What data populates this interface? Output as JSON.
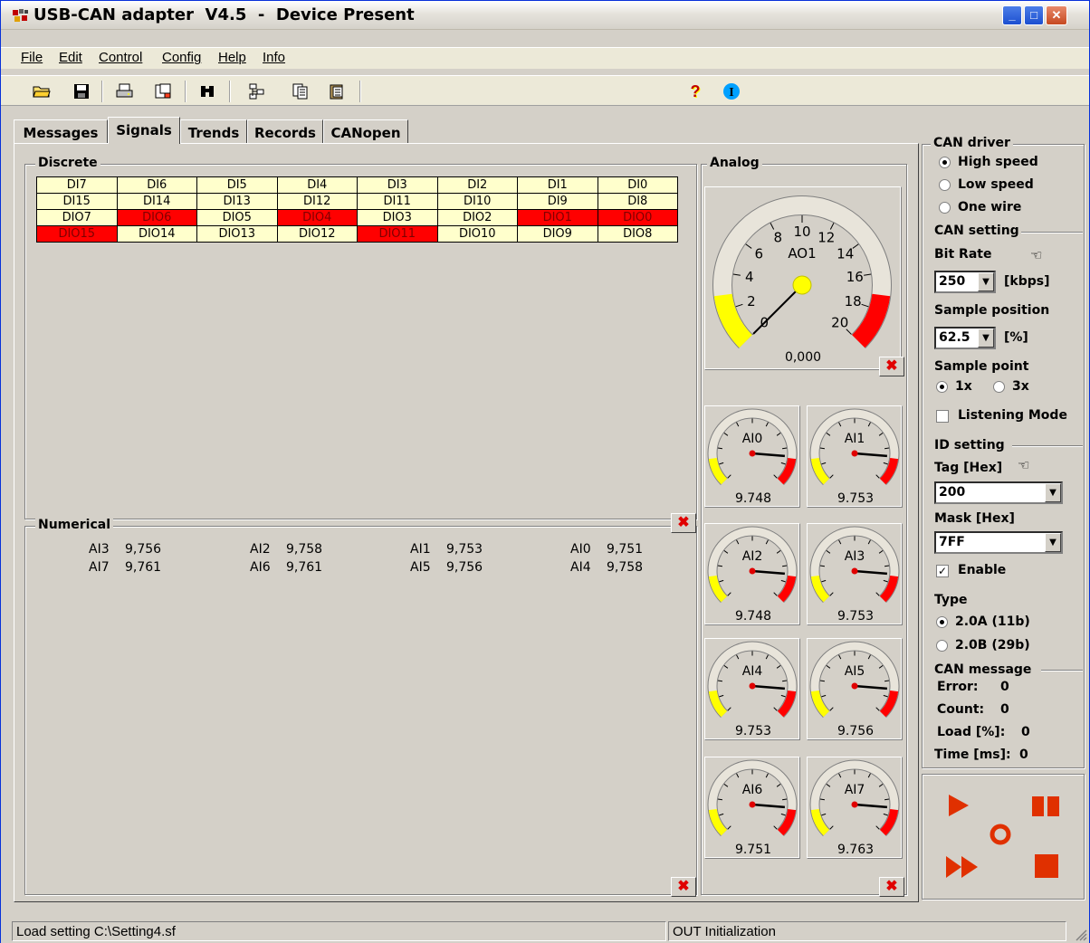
{
  "window": {
    "title": "USB-CAN adapter  V4.5  -  Device Present",
    "app_icon": "usb-can-app-icon",
    "controls": [
      "minimize",
      "maximize",
      "close"
    ]
  },
  "menu": [
    "File",
    "Edit",
    "Control",
    "Config",
    "Help",
    "Info"
  ],
  "toolbar": {
    "icons": [
      "open-folder-icon",
      "save-disk-icon",
      "print-preview-icon",
      "export-icon",
      "find-binoculars-icon",
      "tree-icon",
      "copy-icon",
      "clipboard-icon",
      "help-icon",
      "info-icon"
    ]
  },
  "tabs": [
    "Messages",
    "Signals",
    "Trends",
    "Records",
    "CANopen"
  ],
  "active_tab": "Signals",
  "discrete": {
    "label": "Discrete",
    "rows": [
      [
        {
          "t": "DI7",
          "on": false
        },
        {
          "t": "DI6",
          "on": false
        },
        {
          "t": "DI5",
          "on": false
        },
        {
          "t": "DI4",
          "on": false
        },
        {
          "t": "DI3",
          "on": false
        },
        {
          "t": "DI2",
          "on": false
        },
        {
          "t": "DI1",
          "on": false
        },
        {
          "t": "DI0",
          "on": false
        }
      ],
      [
        {
          "t": "DI15",
          "on": false
        },
        {
          "t": "DI14",
          "on": false
        },
        {
          "t": "DI13",
          "on": false
        },
        {
          "t": "DI12",
          "on": false
        },
        {
          "t": "DI11",
          "on": false
        },
        {
          "t": "DI10",
          "on": false
        },
        {
          "t": "DI9",
          "on": false
        },
        {
          "t": "DI8",
          "on": false
        }
      ],
      [
        {
          "t": "DIO7",
          "on": false
        },
        {
          "t": "DIO6",
          "on": true
        },
        {
          "t": "DIO5",
          "on": false
        },
        {
          "t": "DIO4",
          "on": true
        },
        {
          "t": "DIO3",
          "on": false
        },
        {
          "t": "DIO2",
          "on": false
        },
        {
          "t": "DIO1",
          "on": true
        },
        {
          "t": "DIO0",
          "on": true
        }
      ],
      [
        {
          "t": "DIO15",
          "on": true
        },
        {
          "t": "DIO14",
          "on": false
        },
        {
          "t": "DIO13",
          "on": false
        },
        {
          "t": "DIO12",
          "on": false
        },
        {
          "t": "DIO11",
          "on": true
        },
        {
          "t": "DIO10",
          "on": false
        },
        {
          "t": "DIO9",
          "on": false
        },
        {
          "t": "DIO8",
          "on": false
        }
      ]
    ]
  },
  "numerical": {
    "label": "Numerical",
    "rows": [
      [
        {
          "n": "AI3",
          "v": "9,756"
        },
        {
          "n": "AI2",
          "v": "9,758"
        },
        {
          "n": "AI1",
          "v": "9,753"
        },
        {
          "n": "AI0",
          "v": "9,751"
        }
      ],
      [
        {
          "n": "AI7",
          "v": "9,761"
        },
        {
          "n": "AI6",
          "v": "9,761"
        },
        {
          "n": "AI5",
          "v": "9,756"
        },
        {
          "n": "AI4",
          "v": "9,758"
        }
      ]
    ]
  },
  "analog": {
    "label": "Analog",
    "big_gauge": {
      "name": "AO1",
      "value": "0,000",
      "reading": 0,
      "ticks": [
        "0",
        "2",
        "4",
        "6",
        "8",
        "10",
        "12",
        "14",
        "16",
        "18",
        "20"
      ]
    },
    "small_gauges": [
      {
        "name": "AI0",
        "value": "9.748",
        "reading": 0.85
      },
      {
        "name": "AI1",
        "value": "9.753",
        "reading": 0.85
      },
      {
        "name": "AI2",
        "value": "9.748",
        "reading": 0.85
      },
      {
        "name": "AI3",
        "value": "9.753",
        "reading": 0.85
      },
      {
        "name": "AI4",
        "value": "9.753",
        "reading": 0.85
      },
      {
        "name": "AI5",
        "value": "9.756",
        "reading": 0.85
      },
      {
        "name": "AI6",
        "value": "9.751",
        "reading": 0.85
      },
      {
        "name": "AI7",
        "value": "9.763",
        "reading": 0.85
      }
    ]
  },
  "side": {
    "can_driver_label": "CAN driver",
    "drivers": [
      "High speed",
      "Low speed",
      "One wire"
    ],
    "driver_selected": 0,
    "can_setting_label": "CAN setting",
    "bit_rate_label": "Bit Rate",
    "bit_rate": "250",
    "bit_rate_unit": "[kbps]",
    "sample_position_label": "Sample position",
    "sample_position": "62.5",
    "sample_position_unit": "[%]",
    "sample_point_label": "Sample point",
    "sample_points": [
      "1x",
      "3x"
    ],
    "sample_point_selected": 0,
    "listening_mode_label": "Listening Mode",
    "listening_mode": false,
    "id_setting_label": "ID setting",
    "tag_label": "Tag [Hex]",
    "tag": "200",
    "mask_label": "Mask [Hex]",
    "mask": "7FF",
    "enable_label": "Enable",
    "enable": true,
    "type_label": "Type",
    "types": [
      "2.0A (11b)",
      "2.0B (29b)"
    ],
    "type_selected": 0,
    "can_message_label": "CAN message",
    "error_label": "Error:",
    "error": "0",
    "count_label": "Count:",
    "count": "0",
    "load_label": "Load [%]:",
    "load": "0",
    "time_label": "Time [ms]:",
    "time": "0"
  },
  "transport": [
    "play-icon",
    "pause-icon",
    "record-icon",
    "fast-forward-icon",
    "stop-icon"
  ],
  "colors": {
    "accent_red": "#ff0000",
    "led_off": "#ffffcc",
    "gauge_yellow": "#ffff00",
    "transport_red": "#e03000"
  },
  "status": {
    "left": "Load setting C:\\Setting4.sf",
    "right": "OUT Initialization"
  }
}
